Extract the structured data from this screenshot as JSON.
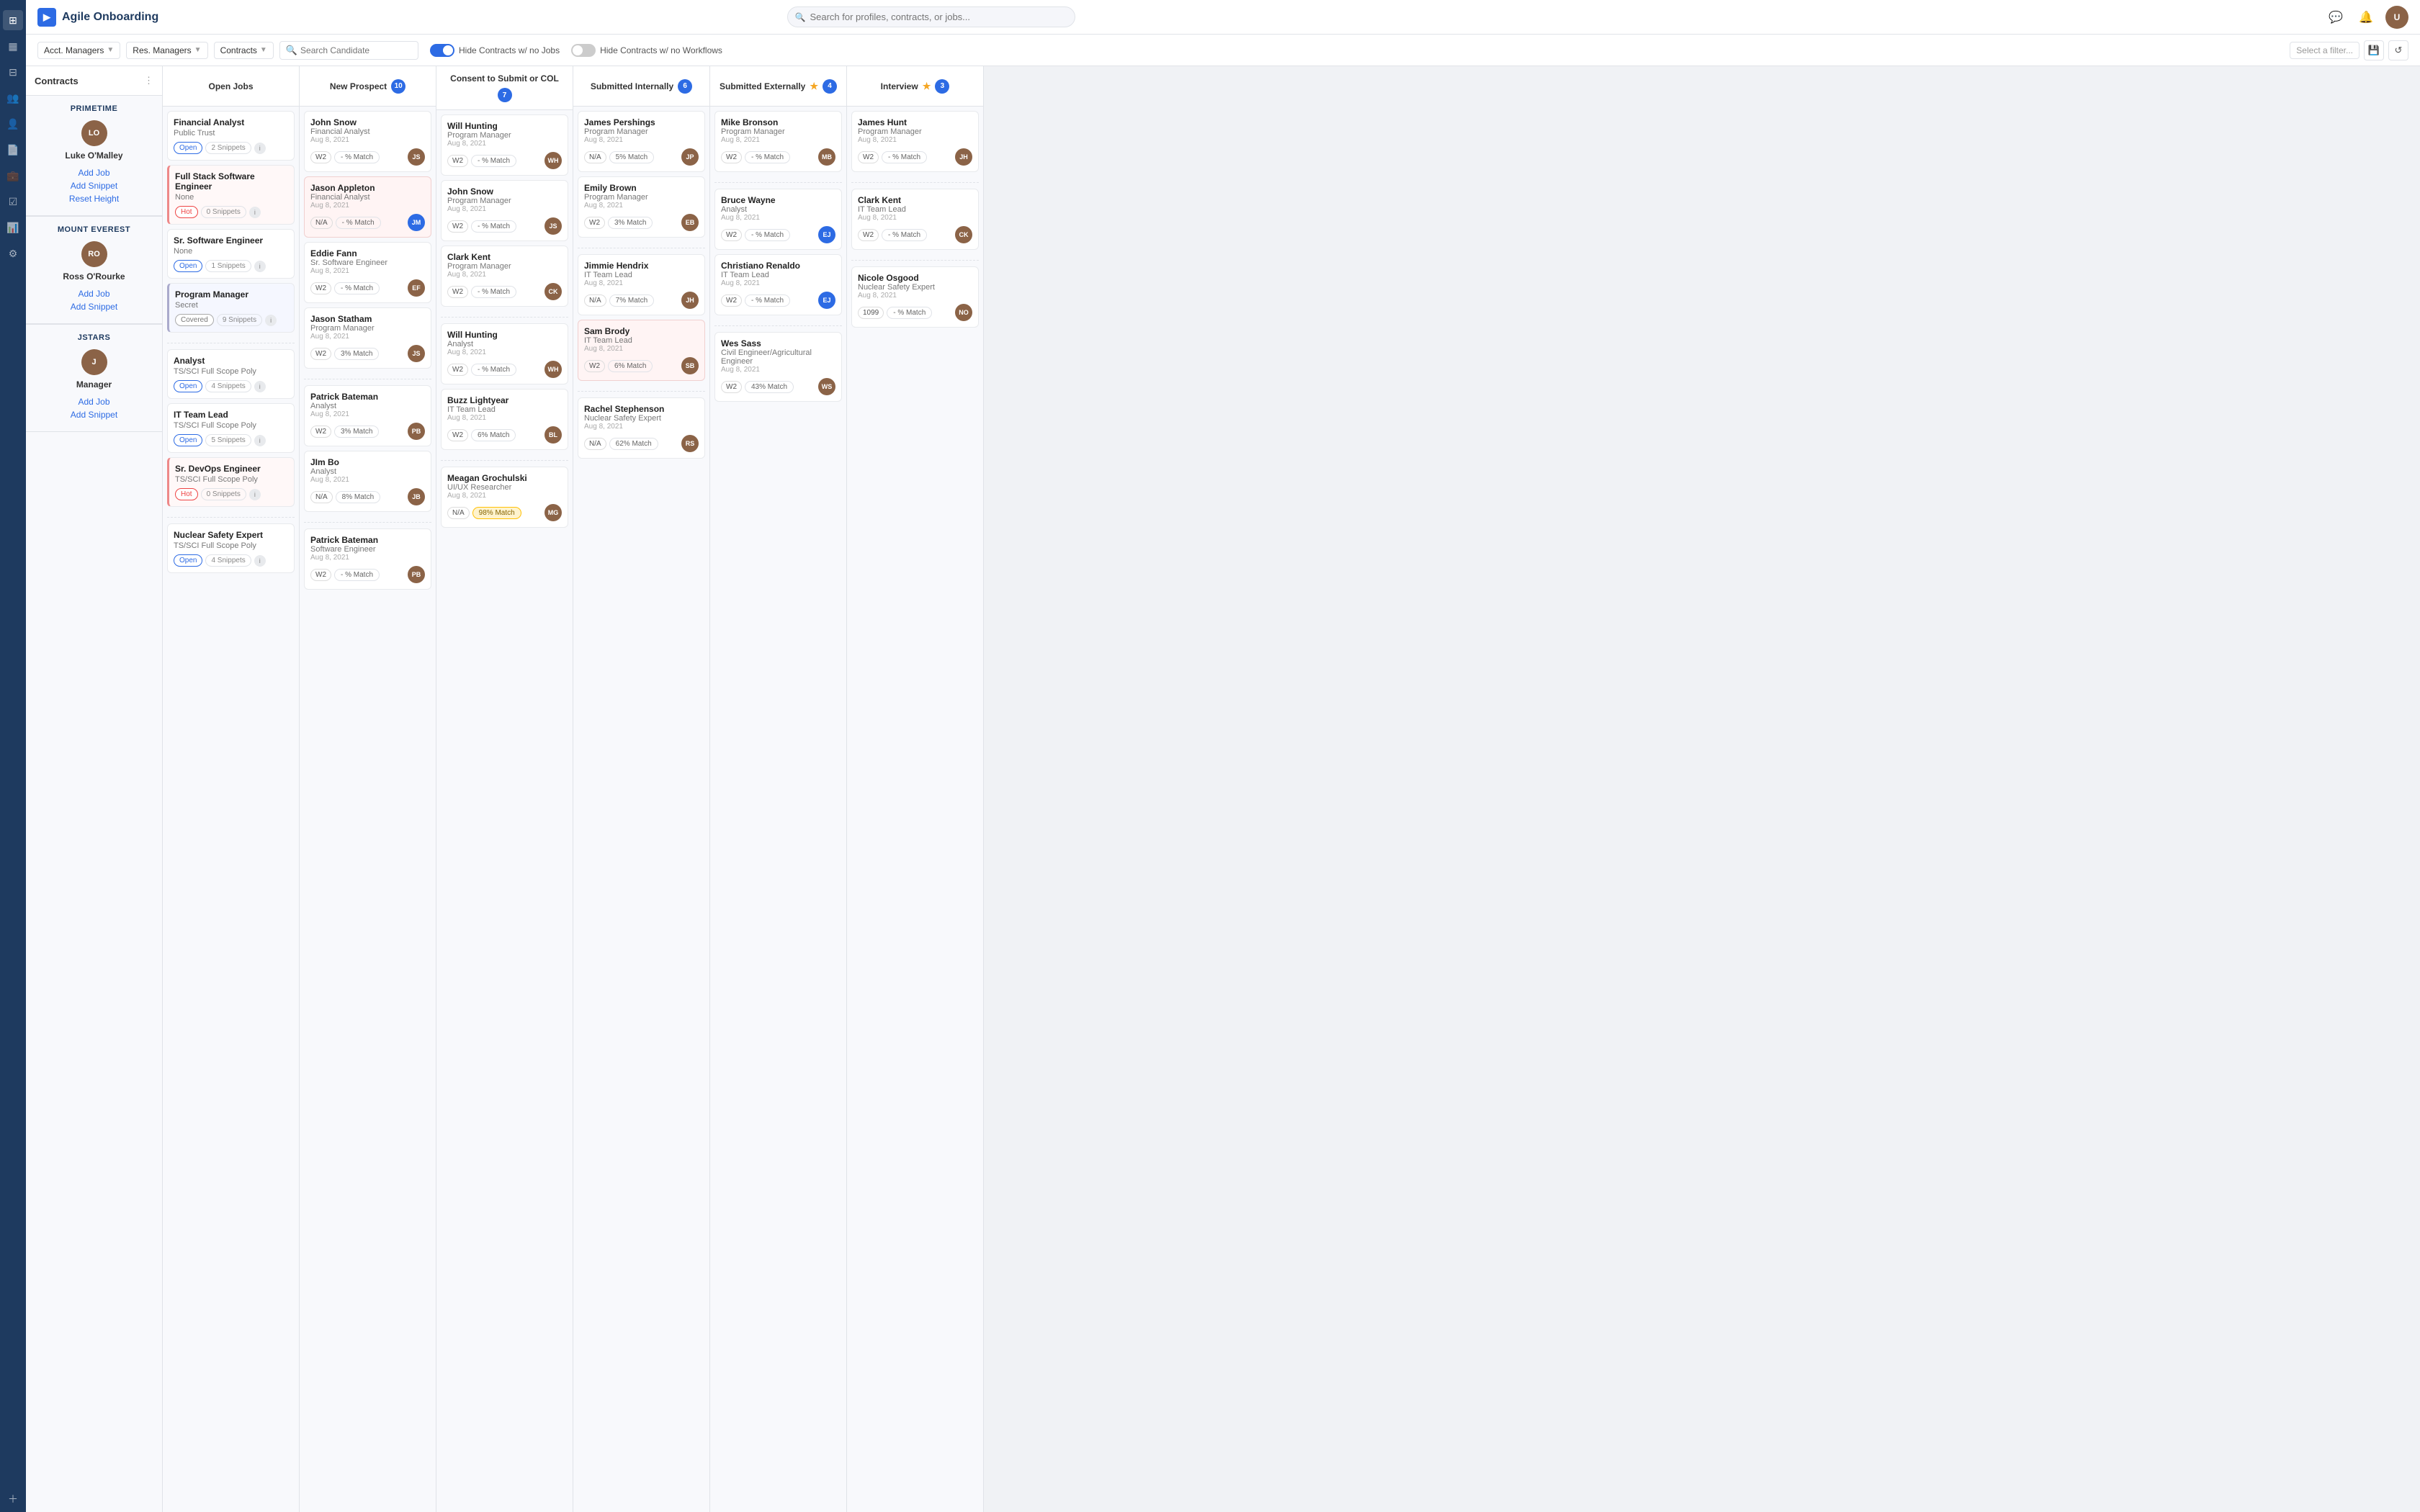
{
  "app": {
    "name": "Agile Onboarding"
  },
  "header": {
    "search_placeholder": "Search for profiles, contracts, or jobs...",
    "logo_text": "Agile Onboarding"
  },
  "toolbar": {
    "acct_managers": "Acct. Managers",
    "res_managers": "Res. Managers",
    "contracts": "Contracts",
    "search_candidate_placeholder": "Search Candidate",
    "hide_no_jobs": "Hide Contracts w/ no Jobs",
    "hide_no_workflows": "Hide Contracts w/ no Workflows",
    "select_filter": "Select a filter..."
  },
  "columns": [
    {
      "id": "open-jobs",
      "title": "Open Jobs",
      "badge": null,
      "star": false
    },
    {
      "id": "new-prospect",
      "title": "New Prospect",
      "badge": "10",
      "star": false
    },
    {
      "id": "consent-submit",
      "title": "Consent to Submit or COL",
      "badge": "7",
      "star": false
    },
    {
      "id": "submitted-internally",
      "title": "Submitted Internally",
      "badge": "6",
      "star": false
    },
    {
      "id": "submitted-externally",
      "title": "Submitted Externally",
      "badge": "4",
      "star": true
    },
    {
      "id": "interview",
      "title": "Interview",
      "badge": "3",
      "star": true
    }
  ],
  "contracts": [
    {
      "name": "PRIMETIME",
      "manager_name": "Luke O'Malley",
      "actions": [
        "Add Job",
        "Add Snippet",
        "Reset Height"
      ],
      "open_jobs": [
        {
          "title": "Financial Analyst",
          "sub": "Public Trust",
          "tag": "Open",
          "tag_type": "open",
          "snippets": "2 Snippets"
        },
        {
          "title": "Full Stack Software Engineer",
          "sub": "None",
          "tag": "Hot",
          "tag_type": "hot",
          "snippets": "0 Snippets"
        },
        {
          "title": "Sr. Software Engineer",
          "sub": "None",
          "tag": "Open",
          "tag_type": "open",
          "snippets": "1 Snippets"
        },
        {
          "title": "Program Manager",
          "sub": "Secret",
          "tag": "Covered",
          "tag_type": "covered",
          "snippets": "9 Snippets"
        }
      ],
      "new_prospect": [
        {
          "name": "John Snow",
          "role": "Financial Analyst",
          "date": "Aug 8, 2021",
          "w2": "W2",
          "match": "- % Match",
          "avatar": "JS",
          "pink": false
        },
        {
          "name": "Jason Appleton",
          "role": "Financial Analyst",
          "date": "Aug 8, 2021",
          "w2": "N/A",
          "match": "- % Match",
          "avatar": "JM",
          "pink": true,
          "avatar_type": "blue"
        },
        {
          "name": "Eddie Fann",
          "role": "Sr. Software Engineer",
          "date": "Aug 8, 2021",
          "w2": "W2",
          "match": "- % Match",
          "avatar": "EF",
          "pink": false
        },
        {
          "name": "Jason Statham",
          "role": "Program Manager",
          "date": "Aug 8, 2021",
          "w2": "W2",
          "match": "3% Match",
          "avatar": "JS2",
          "pink": false
        }
      ],
      "consent_submit": [
        {
          "name": "Will Hunting",
          "role": "Program Manager",
          "date": "Aug 8, 2021",
          "w2": "W2",
          "match": "- % Match",
          "avatar": "WH",
          "pink": false
        },
        {
          "name": "John Snow",
          "role": "Program Manager",
          "date": "Aug 8, 2021",
          "w2": "W2",
          "match": "- % Match",
          "avatar": "JS",
          "pink": false
        },
        {
          "name": "Clark Kent",
          "role": "Program Manager",
          "date": "Aug 8, 2021",
          "w2": "W2",
          "match": "- % Match",
          "avatar": "CK",
          "pink": false
        }
      ],
      "submitted_internally": [
        {
          "name": "James Pershings",
          "role": "Program Manager",
          "date": "Aug 8, 2021",
          "w2": "N/A",
          "match": "5% Match",
          "avatar": "JP",
          "pink": false
        },
        {
          "name": "Emily Brown",
          "role": "Program Manager",
          "date": "Aug 8, 2021",
          "w2": "W2",
          "match": "3% Match",
          "avatar": "EB",
          "pink": false
        }
      ],
      "submitted_externally": [
        {
          "name": "Mike Bronson",
          "role": "Program Manager",
          "date": "Aug 8, 2021",
          "w2": "W2",
          "match": "- % Match",
          "avatar": "MB",
          "pink": false
        }
      ],
      "interview": [
        {
          "name": "James Hunt",
          "role": "Program Manager",
          "date": "Aug 8, 2021",
          "w2": "W2",
          "match": "- % Match",
          "avatar": "JH",
          "pink": false
        }
      ]
    },
    {
      "name": "MOUNT EVEREST",
      "manager_name": "Ross O'Rourke",
      "actions": [
        "Add Job",
        "Add Snippet"
      ],
      "open_jobs": [
        {
          "title": "Analyst",
          "sub": "TS/SCI Full Scope Poly",
          "tag": "Open",
          "tag_type": "open",
          "snippets": "4 Snippets"
        },
        {
          "title": "IT Team Lead",
          "sub": "TS/SCI Full Scope Poly",
          "tag": "Open",
          "tag_type": "open",
          "snippets": "5 Snippets"
        },
        {
          "title": "Sr. DevOps Engineer",
          "sub": "TS/SCI Full Scope Poly",
          "tag": "Hot",
          "tag_type": "hot",
          "snippets": "0 Snippets"
        }
      ],
      "new_prospect": [
        {
          "name": "Patrick Bateman",
          "role": "Analyst",
          "date": "Aug 8, 2021",
          "w2": "W2",
          "match": "3% Match",
          "avatar": "PB",
          "pink": false
        },
        {
          "name": "Jim Bo",
          "role": "Analyst",
          "date": "Aug 8, 2021",
          "w2": "N/A",
          "match": "8% Match",
          "avatar": "JB",
          "pink": false
        }
      ],
      "consent_submit": [
        {
          "name": "Will Hunting",
          "role": "Analyst",
          "date": "Aug 8, 2021",
          "w2": "W2",
          "match": "- % Match",
          "avatar": "WH",
          "pink": false
        },
        {
          "name": "Buzz Lightyear",
          "role": "IT Team Lead",
          "date": "Aug 8, 2021",
          "w2": "W2",
          "match": "6% Match",
          "avatar": "BL",
          "pink": false
        }
      ],
      "submitted_internally": [
        {
          "name": "Jimmie Hendrix",
          "role": "IT Team Lead",
          "date": "Aug 8, 2021",
          "w2": "N/A",
          "match": "7% Match",
          "avatar": "JH",
          "pink": false
        },
        {
          "name": "Sam Brody",
          "role": "IT Team Lead",
          "date": "Aug 8, 2021",
          "w2": "W2",
          "match": "6% Match",
          "avatar": "SB",
          "pink": true
        }
      ],
      "submitted_externally": [
        {
          "name": "Bruce Wayne",
          "role": "Analyst",
          "date": "Aug 8, 2021",
          "w2": "W2",
          "match": "- % Match",
          "avatar": "EJ",
          "pink": false,
          "avatar_type": "blue"
        },
        {
          "name": "Christiano Renaldo",
          "role": "IT Team Lead",
          "date": "Aug 8, 2021",
          "w2": "W2",
          "match": "- % Match",
          "avatar": "EJ",
          "pink": false,
          "avatar_type": "blue"
        }
      ],
      "interview": [
        {
          "name": "Clark Kent",
          "role": "IT Team Lead",
          "date": "Aug 8, 2021",
          "w2": "W2",
          "match": "- % Match",
          "avatar": "CK",
          "pink": false
        }
      ]
    },
    {
      "name": "JSTARS",
      "manager_name": "Manager",
      "actions": [
        "Add Job",
        "Add Snippet"
      ],
      "open_jobs": [
        {
          "title": "Nuclear Safety Expert",
          "sub": "TS/SCI Full Scope Poly",
          "tag": "Open",
          "tag_type": "open",
          "snippets": "4 Snippets"
        }
      ],
      "new_prospect": [
        {
          "name": "Patrick Bateman",
          "role": "Software Engineer",
          "date": "Aug 8, 2021",
          "w2": "W2",
          "match": "- % Match",
          "avatar": "PB",
          "pink": false
        }
      ],
      "consent_submit": [
        {
          "name": "Meagan Grochulski",
          "role": "UI/UX Researcher",
          "date": "Aug 8, 2021",
          "w2": "N/A",
          "match": "98% Match",
          "avatar": "MG",
          "pink": false,
          "match_highlight": true
        }
      ],
      "submitted_internally": [
        {
          "name": "Rachel Stephenson",
          "role": "Nuclear Safety Expert",
          "date": "Aug 8, 2021",
          "w2": "N/A",
          "match": "62% Match",
          "avatar": "RS",
          "pink": false
        }
      ],
      "submitted_externally": [
        {
          "name": "Wes Sass",
          "role": "Civil Engineer/Agricultural Engineer",
          "date": "Aug 8, 2021",
          "w2": "W2",
          "match": "43% Match",
          "avatar": "WS",
          "pink": false
        }
      ],
      "interview": [
        {
          "name": "Nicole Osgood",
          "role": "Nuclear Safety Expert",
          "date": "Aug 8, 2021",
          "w2": "1099",
          "match": "- % Match",
          "avatar": "NO",
          "pink": false
        }
      ]
    }
  ]
}
